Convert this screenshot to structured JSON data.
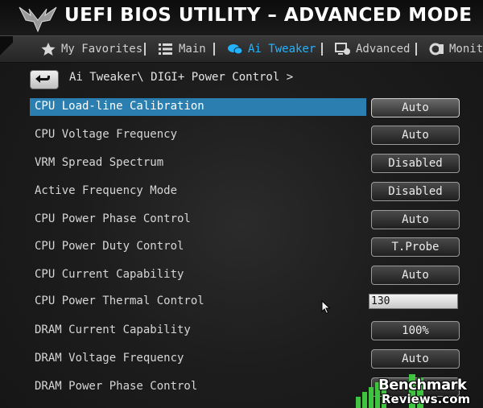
{
  "header": {
    "title": "UEFI BIOS UTILITY – ADVANCED MODE",
    "logo_icon": "tuf-eagle-logo"
  },
  "tabs": [
    {
      "label": "My Favorites",
      "icon": "star-icon",
      "active": false
    },
    {
      "label": "Main",
      "icon": "list-icon",
      "active": false
    },
    {
      "label": "Ai Tweaker",
      "icon": "ai-tweaker-icon",
      "active": true
    },
    {
      "label": "Advanced",
      "icon": "advanced-icon",
      "active": false
    },
    {
      "label": "Monitor",
      "icon": "monitor-icon",
      "active": false
    }
  ],
  "breadcrumb": {
    "back_icon": "back-arrow-icon",
    "path": "Ai Tweaker\\ DIGI+ Power Control >"
  },
  "settings": [
    {
      "label": "CPU Load-line Calibration",
      "value": "Auto",
      "type": "button",
      "selected": true
    },
    {
      "label": "CPU Voltage Frequency",
      "value": "Auto",
      "type": "button",
      "selected": false
    },
    {
      "label": "VRM Spread Spectrum",
      "value": "Disabled",
      "type": "button",
      "selected": false
    },
    {
      "label": "Active Frequency Mode",
      "value": "Disabled",
      "type": "button",
      "selected": false
    },
    {
      "label": "CPU Power Phase Control",
      "value": "Auto",
      "type": "button",
      "selected": false
    },
    {
      "label": "CPU Power Duty Control",
      "value": "T.Probe",
      "type": "button",
      "selected": false
    },
    {
      "label": "CPU Current Capability",
      "value": "Auto",
      "type": "button",
      "selected": false
    },
    {
      "label": "CPU Power Thermal Control",
      "value": "130",
      "type": "input",
      "selected": false
    },
    {
      "label": "DRAM Current Capability",
      "value": "100%",
      "type": "button",
      "selected": false
    },
    {
      "label": "DRAM Voltage Frequency",
      "value": "Auto",
      "type": "button",
      "selected": false
    },
    {
      "label": "DRAM Power Phase Control",
      "value": "",
      "type": "button",
      "selected": false
    }
  ],
  "watermark": {
    "line1": "Benchmark",
    "line2": "Reviews.com",
    "accent": "#3ec43e"
  },
  "colors": {
    "selection": "#2a7fb0",
    "active_tab": "#22b3ff"
  }
}
